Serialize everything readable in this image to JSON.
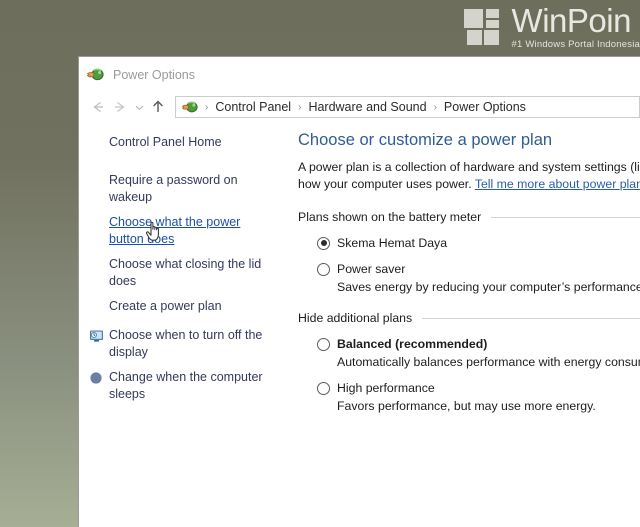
{
  "watermark": {
    "title": "WinPoin",
    "subtitle": "#1 Windows Portal Indonesia"
  },
  "window": {
    "title": "Power Options",
    "icon": "power-plug-icon"
  },
  "nav": {
    "back_icon": "arrow-left-icon",
    "forward_icon": "arrow-right-icon",
    "history_icon": "chevron-down-icon",
    "up_icon": "arrow-up-icon",
    "breadcrumb": [
      "Control Panel",
      "Hardware and Sound",
      "Power Options"
    ],
    "separator": "›"
  },
  "sidebar": {
    "home_label": "Control Panel Home",
    "items": [
      {
        "label": "Require a password on wakeup",
        "icon": null,
        "state": "normal"
      },
      {
        "label": "Choose what the power button does",
        "icon": null,
        "state": "hovered"
      },
      {
        "label": "Choose what closing the lid does",
        "icon": null,
        "state": "normal"
      },
      {
        "label": "Create a power plan",
        "icon": null,
        "state": "normal"
      },
      {
        "label": "Choose when to turn off the display",
        "icon": "monitor-icon",
        "state": "normal"
      },
      {
        "label": "Change when the computer sleeps",
        "icon": "moon-icon",
        "state": "normal"
      }
    ]
  },
  "content": {
    "heading": "Choose or customize a power plan",
    "intro_line1": "A power plan is a collection of hardware and system settings (like",
    "intro_line2_pre": "how your computer uses power. ",
    "intro_link": "Tell me more about power plans",
    "sections": [
      {
        "heading": "Plans shown on the battery meter",
        "plans": [
          {
            "name": "Skema Hemat Daya",
            "selected": true,
            "bold": false,
            "desc": ""
          },
          {
            "name": "Power saver",
            "selected": false,
            "bold": false,
            "desc": "Saves energy by reducing your computer’s performance w"
          }
        ]
      },
      {
        "heading": "Hide additional plans",
        "plans": [
          {
            "name": "Balanced (recommended)",
            "selected": false,
            "bold": true,
            "desc": "Automatically balances performance with energy consump"
          },
          {
            "name": "High performance",
            "selected": false,
            "bold": false,
            "desc": "Favors performance, but may use more energy."
          }
        ]
      }
    ]
  },
  "cursor": {
    "icon": "hand-pointer-cursor"
  },
  "colors": {
    "desktop_top": "#6e6e5c",
    "desktop_bottom": "#a6ae94",
    "heading_blue": "#2f5c97",
    "link_blue": "#2b2b66",
    "hover_blue": "#1b4faa"
  }
}
